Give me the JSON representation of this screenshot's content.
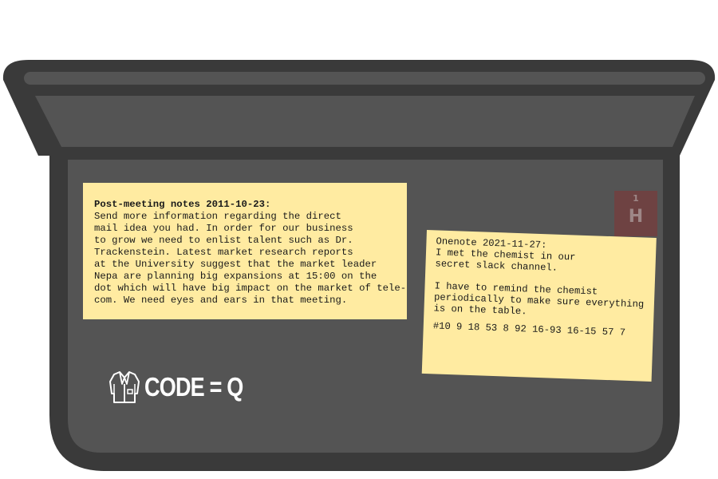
{
  "scene": {
    "colors": {
      "case_outer": "#3a3a3a",
      "case_inner": "#545454",
      "lid_panel": "#545454",
      "handle": "#545454",
      "note_paper": "#ffeba1",
      "h_tile": "#6e4242"
    }
  },
  "notes": {
    "post_meeting": {
      "heading": "Post-meeting notes 2011-10-23:",
      "lines": [
        "Send more information regarding the direct",
        "mail idea you had. In order for our business",
        "to grow we need to enlist talent such as Dr.",
        "Trackenstein. Latest market research reports",
        "at the University suggest that the market leader",
        "Nepa are planning big expansions at 15:00 on the",
        "dot which will have big impact on the market of tele-",
        "com. We need eyes and ears in that meeting."
      ]
    },
    "onenote": {
      "lines": [
        "Onenote 2021-11-27:",
        "I met the chemist in our",
        "secret slack channel.",
        "",
        "I have to remind the chemist",
        "periodically to make sure everything",
        "is on the table."
      ],
      "code": "#10 9 18 53 8 92 16-93 16-15 57 7"
    }
  },
  "tile": {
    "number": "1",
    "letter": "H"
  },
  "code_label": {
    "icon": "lab-coat-icon",
    "text": "CODE = Q"
  }
}
